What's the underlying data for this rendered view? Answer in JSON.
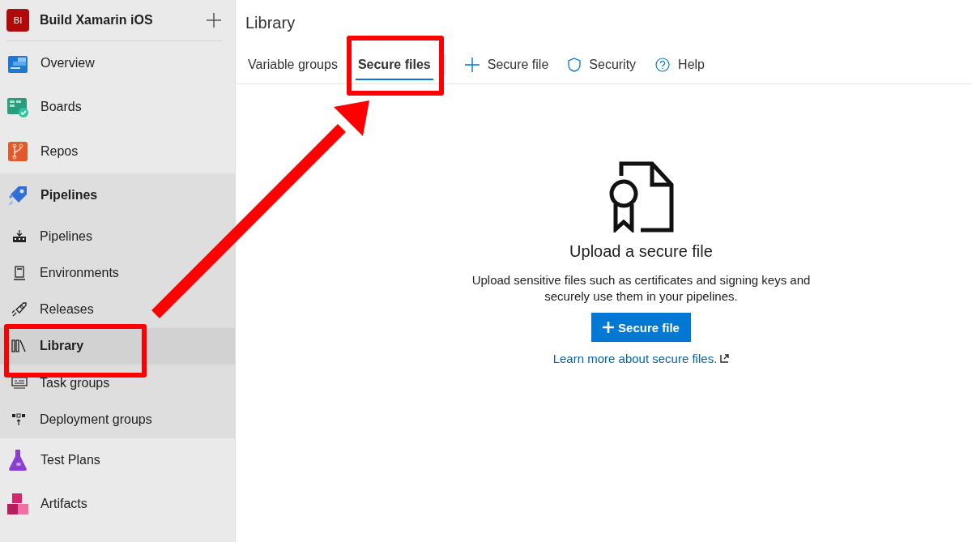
{
  "sidebar": {
    "project": {
      "initials": "BI",
      "name": "Build Xamarin iOS"
    },
    "hubs": [
      {
        "label": "Overview",
        "selected": false
      },
      {
        "label": "Boards",
        "selected": false
      },
      {
        "label": "Repos",
        "selected": false
      },
      {
        "label": "Pipelines",
        "selected": true,
        "children": [
          {
            "label": "Pipelines",
            "selected": false
          },
          {
            "label": "Environments",
            "selected": false
          },
          {
            "label": "Releases",
            "selected": false
          },
          {
            "label": "Library",
            "selected": true
          },
          {
            "label": "Task groups",
            "selected": false
          },
          {
            "label": "Deployment groups",
            "selected": false
          }
        ]
      },
      {
        "label": "Test Plans",
        "selected": false
      },
      {
        "label": "Artifacts",
        "selected": false
      }
    ]
  },
  "page": {
    "title": "Library",
    "tabs": [
      {
        "label": "Variable groups",
        "selected": false
      },
      {
        "label": "Secure files",
        "selected": true
      }
    ],
    "actions": [
      {
        "kind": "add",
        "label": "Secure file"
      },
      {
        "kind": "security",
        "label": "Security"
      },
      {
        "kind": "help",
        "label": "Help"
      }
    ],
    "empty_state": {
      "title": "Upload a secure file",
      "description": "Upload sensitive files such as certificates and signing keys and securely use them in your pipelines.",
      "button": "Secure file",
      "link": "Learn more about secure files."
    }
  },
  "annotations": [
    {
      "kind": "box"
    },
    {
      "kind": "box"
    },
    {
      "kind": "arrow"
    }
  ]
}
